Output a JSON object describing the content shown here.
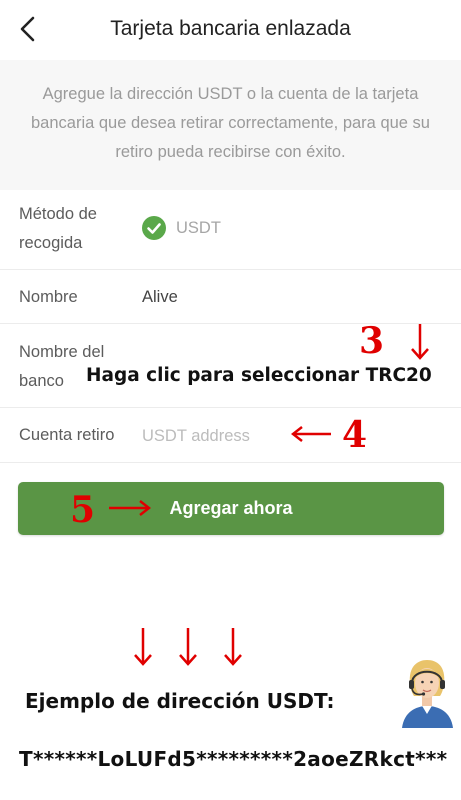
{
  "header": {
    "title": "Tarjeta bancaria enlazada"
  },
  "notice": "Agregue la dirección USDT o la cuenta de la tarjeta bancaria que desea retirar correctamente, para que su retiro pueda recibirse con éxito.",
  "form": {
    "method": {
      "label_line1": "Método de",
      "label_line2": "recogida",
      "value": "USDT"
    },
    "name": {
      "label": "Nombre",
      "value": "Alive"
    },
    "bank": {
      "label_line1": "Nombre del",
      "label_line2": "banco",
      "hint": "Haga clic para seleccionar TRC20"
    },
    "account": {
      "label": "Cuenta retiro",
      "placeholder": "USDT address",
      "value": ""
    }
  },
  "add_button": {
    "label": "Agregar ahora"
  },
  "annotations": {
    "step3": "3",
    "step4": "4",
    "step5": "5",
    "color": "#e00000"
  },
  "example": {
    "title": "Ejemplo de dirección USDT:",
    "address": "T******LoLUFd5*********2aoeZRkct***"
  },
  "icons": {
    "back": "chevron-left-icon",
    "check": "check-circle-icon",
    "agent": "support-agent-icon"
  }
}
